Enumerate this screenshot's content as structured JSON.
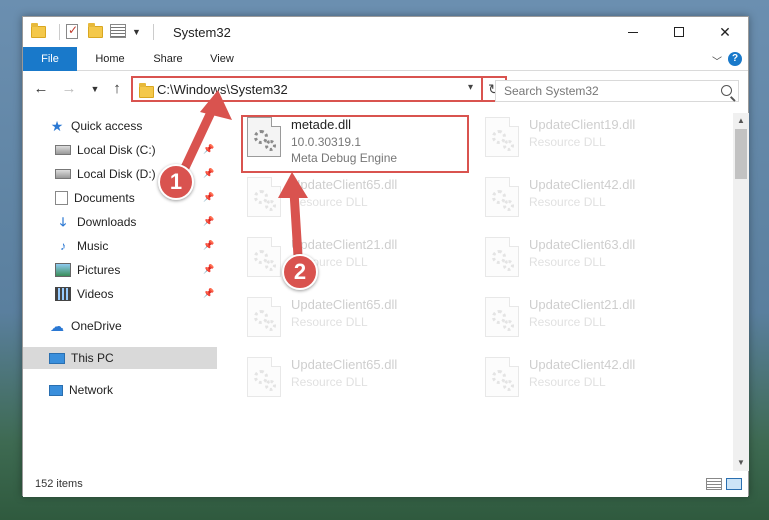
{
  "window": {
    "title": "System32"
  },
  "ribbon": {
    "tabs": [
      "File",
      "Home",
      "Share",
      "View"
    ],
    "help_label": "?"
  },
  "nav": {
    "address": "C:\\Windows\\System32",
    "search_placeholder": "Search System32"
  },
  "sidebar": {
    "items": [
      {
        "label": "Quick access",
        "icon": "star-icon"
      },
      {
        "label": "Local Disk (C:)",
        "icon": "disk-icon"
      },
      {
        "label": "Local Disk (D:)",
        "icon": "disk-icon"
      },
      {
        "label": "Documents",
        "icon": "document-icon"
      },
      {
        "label": "Downloads",
        "icon": "download-icon"
      },
      {
        "label": "Music",
        "icon": "music-icon"
      },
      {
        "label": "Pictures",
        "icon": "pictures-icon"
      },
      {
        "label": "Videos",
        "icon": "videos-icon"
      },
      {
        "label": "OneDrive",
        "icon": "cloud-icon"
      },
      {
        "label": "This PC",
        "icon": "computer-icon"
      },
      {
        "label": "Network",
        "icon": "network-icon"
      }
    ]
  },
  "files": {
    "main": {
      "name": "metade.dll",
      "version": "10.0.30319.1",
      "description": "Meta Debug Engine"
    },
    "ghost": [
      {
        "name": "UpdateClient19.dll",
        "type": "Resource DLL"
      },
      {
        "name": "UpdateClient65.dll",
        "type": "Resource DLL"
      },
      {
        "name": "UpdateClient42.dll",
        "type": "Resource DLL"
      },
      {
        "name": "UpdateClient21.dll",
        "type": "Resource DLL"
      },
      {
        "name": "UpdateClient63.dll",
        "type": "Resource DLL"
      },
      {
        "name": "UpdateClient65.dll",
        "type": "Resource DLL"
      },
      {
        "name": "UpdateClient21.dll",
        "type": "Resource DLL"
      },
      {
        "name": "UpdateClient65.dll",
        "type": "Resource DLL"
      },
      {
        "name": "UpdateClient42.dll",
        "type": "Resource DLL"
      }
    ]
  },
  "status": {
    "count": "152 items"
  },
  "annotations": {
    "step1": "1",
    "step2": "2",
    "color": "#d9534f"
  }
}
